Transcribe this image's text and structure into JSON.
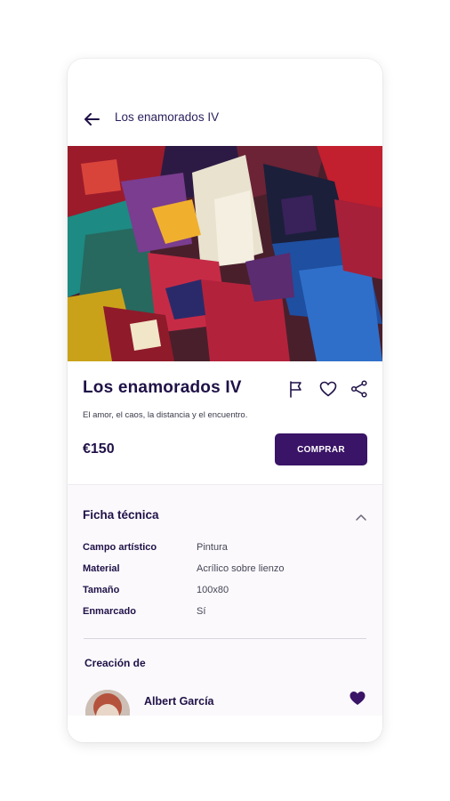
{
  "header": {
    "title": "Los enamorados IV"
  },
  "gallery": {
    "slides": 2,
    "active_index": 0
  },
  "artwork": {
    "title": "Los enamorados IV",
    "description": "El amor, el caos, la distancia y el encuentro.",
    "price": "€150",
    "buy_label": "COMPRAR"
  },
  "technical_sheet": {
    "title": "Ficha técnica",
    "rows": [
      {
        "label": "Campo artístico",
        "value": "Pintura"
      },
      {
        "label": "Material",
        "value": "Acrílico sobre lienzo"
      },
      {
        "label": "Tamaño",
        "value": "100x80"
      },
      {
        "label": "Enmarcado",
        "value": "Sí"
      }
    ]
  },
  "creator": {
    "section_title": "Creación de",
    "name": "Albert García"
  },
  "colors": {
    "primary": "#3a1466",
    "text_dark": "#1f1147",
    "accent_heart": "#3a1466"
  },
  "icons": {
    "back": "arrow-left-icon",
    "flag": "flag-icon",
    "heart": "heart-outline-icon",
    "share": "share-icon",
    "collapse": "chevron-up-icon",
    "favorite": "heart-filled-icon"
  }
}
